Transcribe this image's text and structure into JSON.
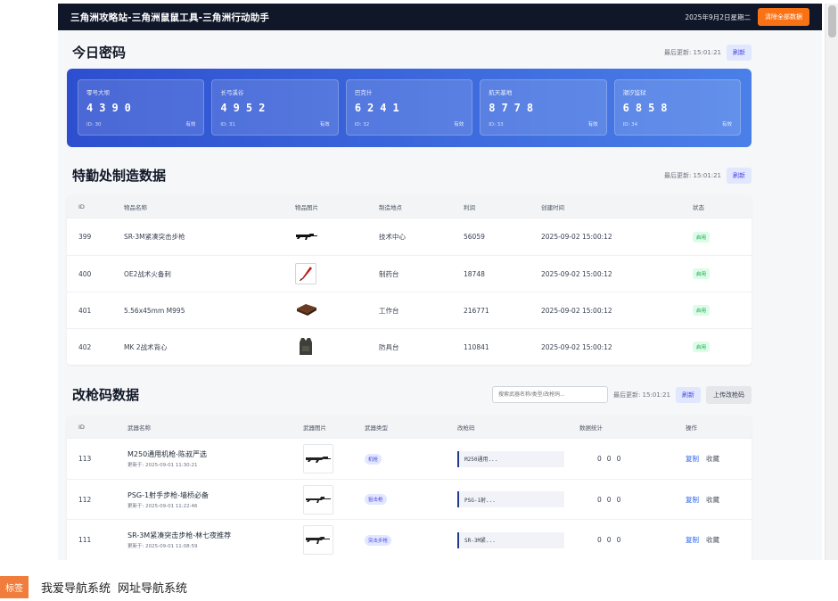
{
  "topbar": {
    "title": "三角洲攻略站-三角洲鼠鼠工具-三角洲行动助手",
    "date": "2025年9月2日星期二",
    "clear_button": "清除全部数据"
  },
  "passwords": {
    "title": "今日密码",
    "updated": "最后更新: 15:01:21",
    "refresh": "刷新",
    "cards": [
      {
        "name": "零号大坝",
        "code": "4390",
        "id": "ID: 30",
        "status": "有效"
      },
      {
        "name": "长弓溪谷",
        "code": "4952",
        "id": "ID: 31",
        "status": "有效"
      },
      {
        "name": "巴克什",
        "code": "6241",
        "id": "ID: 32",
        "status": "有效"
      },
      {
        "name": "航天基地",
        "code": "8778",
        "id": "ID: 33",
        "status": "有效"
      },
      {
        "name": "潮汐监狱",
        "code": "6858",
        "id": "ID: 34",
        "status": "有效"
      }
    ]
  },
  "crafting": {
    "title": "特勤处制造数据",
    "updated": "最后更新: 15:01:21",
    "refresh": "刷新",
    "headers": [
      "ID",
      "物品名称",
      "物品图片",
      "制造地点",
      "利润",
      "创建时间",
      "状态"
    ],
    "rows": [
      {
        "id": "399",
        "name": "SR-3M紧凑突击步枪",
        "place": "技术中心",
        "profit": "56059",
        "time": "2025-09-02 15:00:12",
        "status": "启用",
        "icon": "rifle-icon"
      },
      {
        "id": "400",
        "name": "OE2战术火备刺",
        "place": "制药台",
        "profit": "18748",
        "time": "2025-09-02 15:00:12",
        "status": "启用",
        "icon": "knife-icon"
      },
      {
        "id": "401",
        "name": "5.56x45mm M995",
        "place": "工作台",
        "profit": "216771",
        "time": "2025-09-02 15:00:12",
        "status": "启用",
        "icon": "ammo-box-icon"
      },
      {
        "id": "402",
        "name": "MK 2战术背心",
        "place": "防具台",
        "profit": "110841",
        "time": "2025-09-02 15:00:12",
        "status": "启用",
        "icon": "vest-icon"
      }
    ]
  },
  "mods": {
    "title": "改枪码数据",
    "search_placeholder": "搜索武器名称/类型/改枪码...",
    "updated": "最后更新: 15:01:21",
    "refresh": "刷新",
    "upload": "上传改枪码",
    "headers": [
      "ID",
      "武器名称",
      "武器图片",
      "武器类型",
      "改枪码",
      "数据统计",
      "操作"
    ],
    "rows": [
      {
        "id": "113",
        "name": "M250通用机枪-陈叔严选",
        "updated": "更新于: 2025-09-01 11:30:21",
        "type": "机枪",
        "code": "M250通用...",
        "stats": [
          "0",
          "0",
          "0"
        ],
        "copy": "复制",
        "fav": "收藏"
      },
      {
        "id": "112",
        "name": "PSG-1射手步枪-墙桥必备",
        "updated": "更新于: 2025-09-01 11:22:46",
        "type": "狙击枪",
        "code": "PSG-1射...",
        "stats": [
          "0",
          "0",
          "0"
        ],
        "copy": "复制",
        "fav": "收藏"
      },
      {
        "id": "111",
        "name": "SR-3M紧凑突击步枪-林七夜推荐",
        "updated": "更新于: 2025-09-01 11:08:59",
        "type": "突击步枪",
        "code": "SR-3M紧...",
        "stats": [
          "0",
          "0",
          "0"
        ],
        "copy": "复制",
        "fav": "收藏"
      }
    ]
  },
  "tags": {
    "label": "标签",
    "items": [
      "我爱导航系统",
      "网址导航系统"
    ]
  }
}
